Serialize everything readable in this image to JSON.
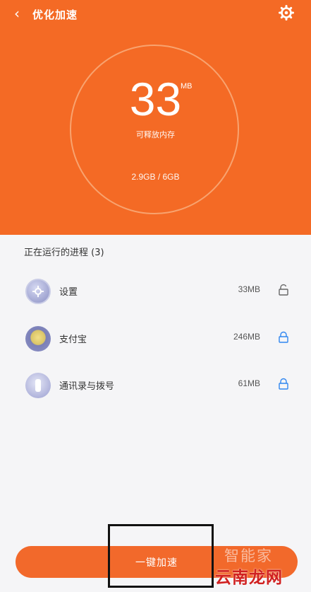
{
  "header": {
    "title": "优化加速",
    "back_icon": "chevron-left-icon",
    "settings_icon": "gear-icon",
    "background_color": "#f46a25"
  },
  "memory": {
    "free_value": "33",
    "free_unit": "MB",
    "free_label": "可释放内存",
    "usage": "2.9GB / 6GB"
  },
  "process_section": {
    "title": "正在运行的进程 (3)",
    "items": [
      {
        "name": "设置",
        "size": "33MB",
        "icon": "settings-app-icon",
        "lock": "unlocked-icon"
      },
      {
        "name": "支付宝",
        "size": "246MB",
        "icon": "alipay-app-icon",
        "lock": "locked-icon"
      },
      {
        "name": "通讯录与拨号",
        "size": "61MB",
        "icon": "phone-app-icon",
        "lock": "locked-icon"
      }
    ]
  },
  "action": {
    "accelerate_label": "一键加速",
    "accent_color": "#f2692b"
  },
  "watermark": {
    "line1": "智能家",
    "line2": "云南龙网"
  }
}
